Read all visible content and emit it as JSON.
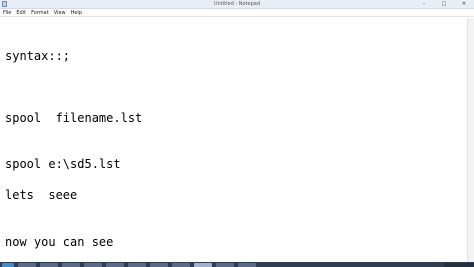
{
  "window": {
    "title": "Untitled - Notepad",
    "controls": [
      "–",
      "□",
      "✕"
    ]
  },
  "menu": [
    "File",
    "Edit",
    "Format",
    "View",
    "Help"
  ],
  "editor": {
    "lines": [
      "syntax::;",
      "spool  filename.lst",
      "spool e:\\sd5.lst",
      "lets  seee",
      "now you can see"
    ]
  },
  "taskbar": {
    "items": [
      "start",
      "task",
      "task",
      "task",
      "task",
      "task",
      "task",
      "task",
      "task",
      "notepad",
      "task",
      "task"
    ]
  }
}
